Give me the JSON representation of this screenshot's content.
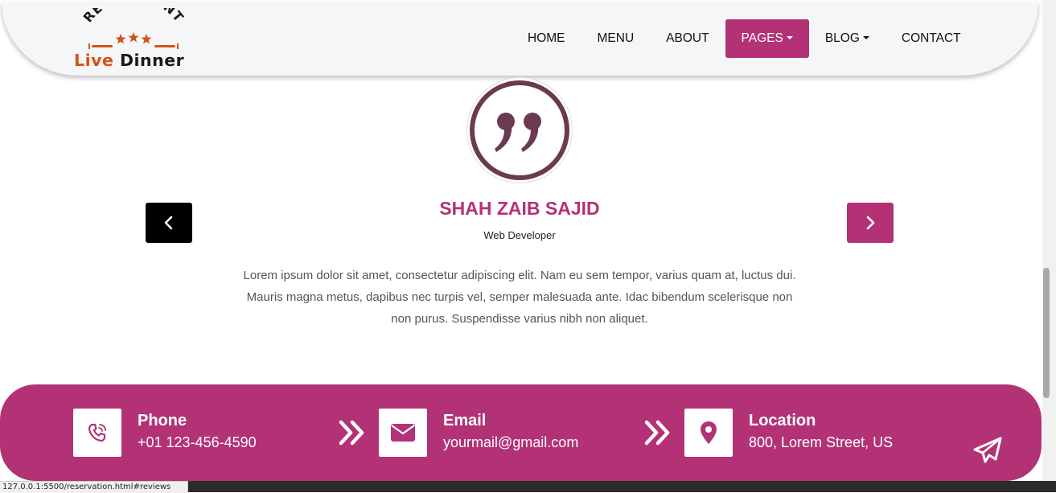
{
  "logo": {
    "top_text": "RESTAURANT",
    "word1": "Live",
    "word2": "Dinner"
  },
  "nav": {
    "items": [
      {
        "label": "HOME"
      },
      {
        "label": "MENU"
      },
      {
        "label": "ABOUT"
      },
      {
        "label": "PAGES",
        "active": true,
        "dropdown": true
      },
      {
        "label": "BLOG",
        "dropdown": true
      },
      {
        "label": "CONTACT"
      }
    ]
  },
  "testimonial": {
    "icon": "quote-icon",
    "name": "SHAH ZAIB SAJID",
    "role": "Web Developer",
    "text_lines": [
      "Lorem ipsum dolor sit amet, consectetur adipiscing elit. Nam eu sem tempor, varius quam at, luctus dui.",
      "Mauris magna metus, dapibus nec turpis vel, semper malesuada ante. Idac bibendum scelerisque non",
      "non purus. Suspendisse varius nibh non aliquet."
    ]
  },
  "contact": {
    "phone": {
      "title": "Phone",
      "value": "+01 123-456-4590",
      "icon": "phone-icon"
    },
    "email": {
      "title": "Email",
      "value": "yourmail@gmail.com",
      "icon": "envelope-icon"
    },
    "location": {
      "title": "Location",
      "value": "800, Lorem Street, US",
      "icon": "map-pin-icon"
    }
  },
  "status_url": "127.0.0.1:5500/reservation.html#reviews",
  "colors": {
    "accent": "#b23275",
    "logo_orange": "#d35318",
    "quote_ring": "#6b3a50"
  }
}
